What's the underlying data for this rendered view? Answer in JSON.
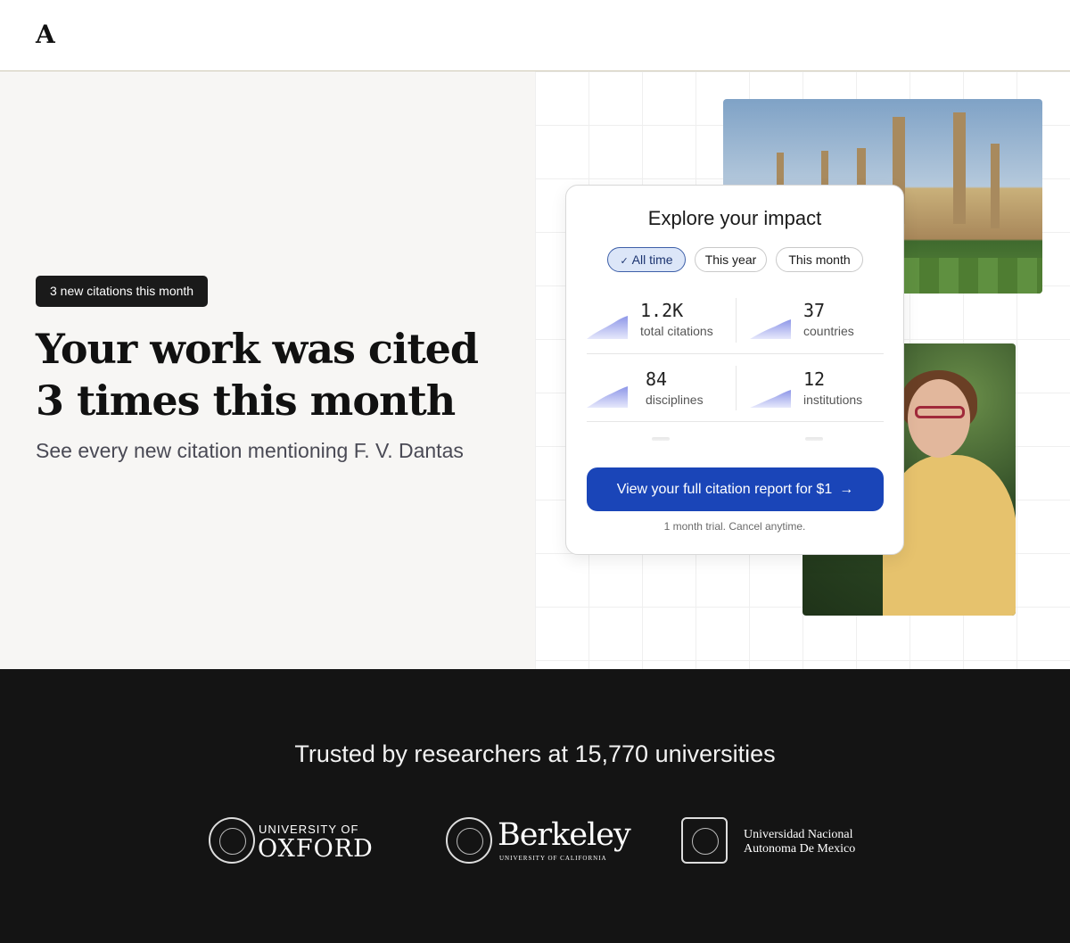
{
  "header": {
    "logo": "A"
  },
  "hero": {
    "badge": "3 new citations this month",
    "headline": "Your work was cited 3 times this month",
    "subhead": "See every new citation mentioning F. V. Dantas"
  },
  "card": {
    "title": "Explore your impact",
    "filters": [
      {
        "label": "All time",
        "active": true
      },
      {
        "label": "This year",
        "active": false
      },
      {
        "label": "This month",
        "active": false
      }
    ],
    "stats": [
      {
        "value": "1.2K",
        "label": "total citations"
      },
      {
        "value": "37",
        "label": "countries"
      },
      {
        "value": "84",
        "label": "disciplines"
      },
      {
        "value": "12",
        "label": "institutions"
      }
    ],
    "cta": {
      "label": "View your full citation report for $1",
      "icon": "arrow-right-icon"
    },
    "trial_note": "1 month trial. Cancel anytime."
  },
  "trusted": {
    "title": "Trusted by researchers at 15,770 universities",
    "universities": [
      {
        "line1": "UNIVERSITY OF",
        "line2": "OXFORD"
      },
      {
        "line1": "Berkeley",
        "line2": "UNIVERSITY OF CALIFORNIA"
      },
      {
        "line1": "Universidad Nacional",
        "line2": "Autonoma De Mexico"
      }
    ]
  },
  "colors": {
    "accent": "#1a45b8",
    "band": "#141414",
    "chip_active": "#dce6f8"
  }
}
